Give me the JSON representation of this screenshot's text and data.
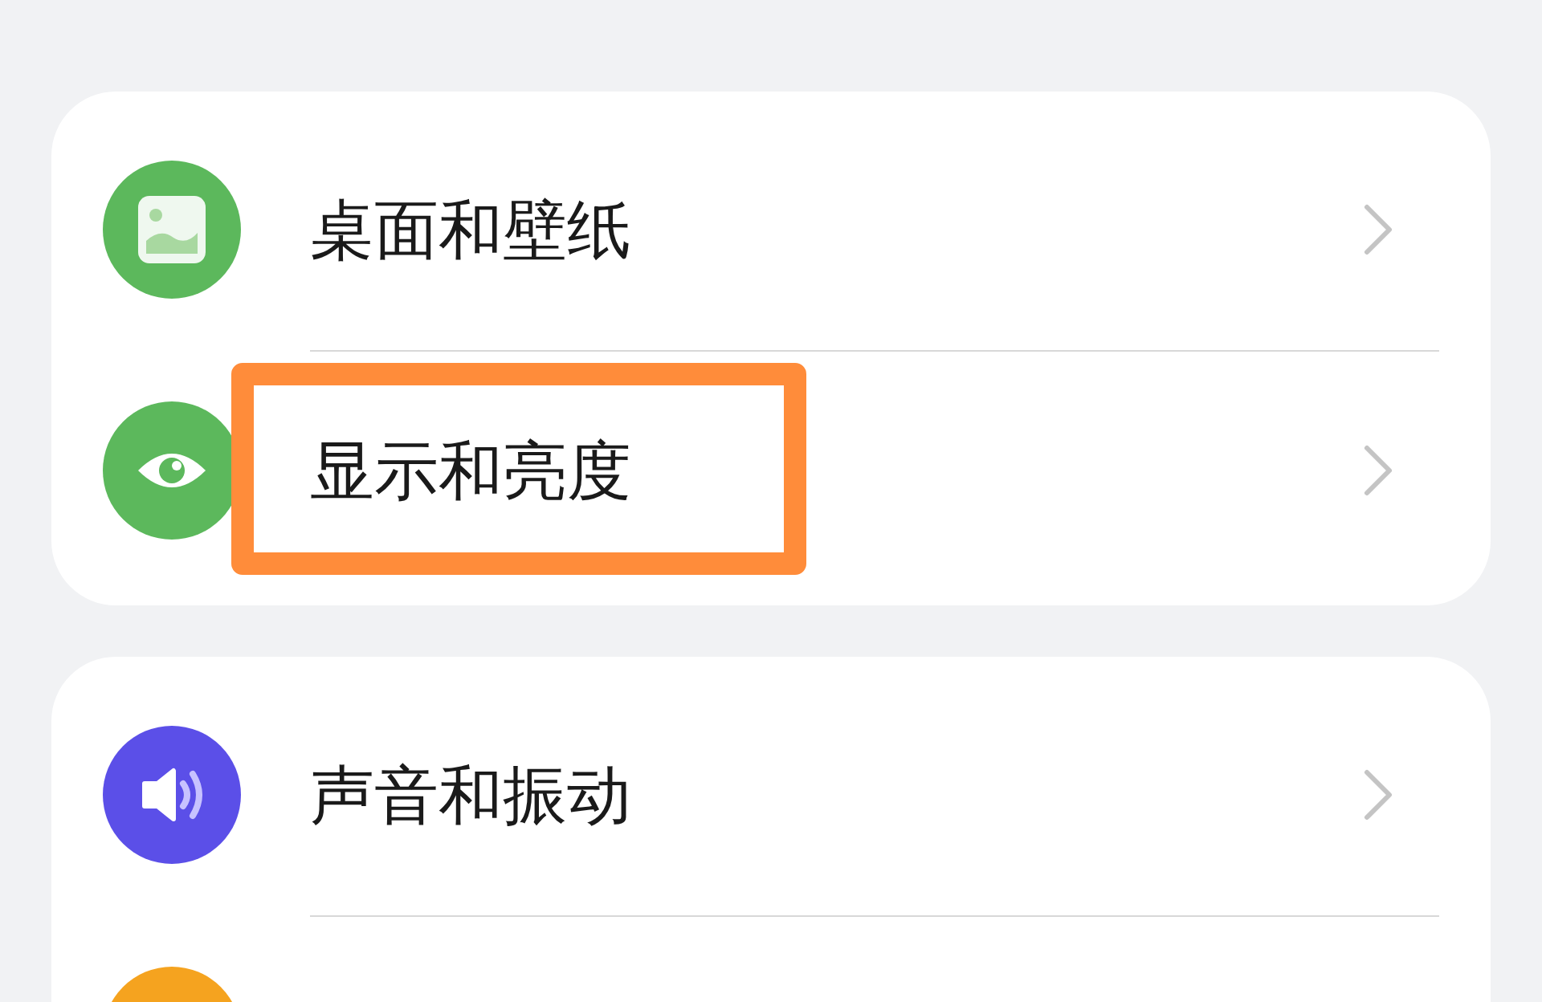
{
  "groups": [
    {
      "items": [
        {
          "kind": "picture",
          "color": "#5cb85c",
          "label": "桌面和壁纸",
          "highlighted": false
        },
        {
          "kind": "eye",
          "color": "#5cb85c",
          "label": "显示和亮度",
          "highlighted": true
        }
      ]
    },
    {
      "items": [
        {
          "kind": "speaker",
          "color": "#5b4fe8",
          "label": "声音和振动",
          "highlighted": false
        },
        {
          "kind": "partial",
          "color": "#f5a31f",
          "highlighted": false
        }
      ]
    }
  ]
}
